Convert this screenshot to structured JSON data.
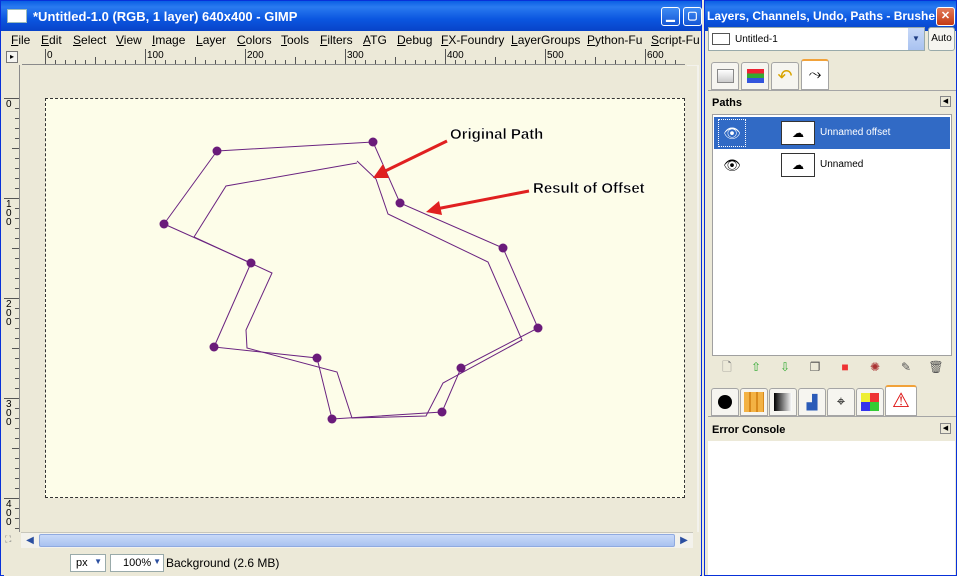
{
  "gimp": {
    "title": "*Untitled-1.0 (RGB, 1 layer) 640x400 - GIMP",
    "menu": [
      "File",
      "Edit",
      "Select",
      "View",
      "Image",
      "Layer",
      "Colors",
      "Tools",
      "Filters",
      "ATG",
      "Debug",
      "FX-Foundry",
      "LayerGroups",
      "Python-Fu",
      "Script-Fu"
    ],
    "ruler_h": [
      "0",
      "100",
      "200",
      "300",
      "400",
      "500",
      "600"
    ],
    "ruler_v": [
      "0",
      "100",
      "200",
      "300",
      "400"
    ],
    "annotations": {
      "original": "Original Path",
      "offset": "Result of Offset"
    },
    "status": {
      "unit": "px",
      "zoom": "100%",
      "info": "Background (2.6 MB)"
    }
  },
  "dock": {
    "title": "Layers, Channels, Undo, Paths - Brushe...",
    "image_select": "Untitled-1",
    "auto_label": "Auto",
    "paths_label": "Paths",
    "paths": [
      {
        "name": "Unnamed offset",
        "selected": true
      },
      {
        "name": "Unnamed",
        "selected": false
      }
    ],
    "error_console_label": "Error Console"
  }
}
